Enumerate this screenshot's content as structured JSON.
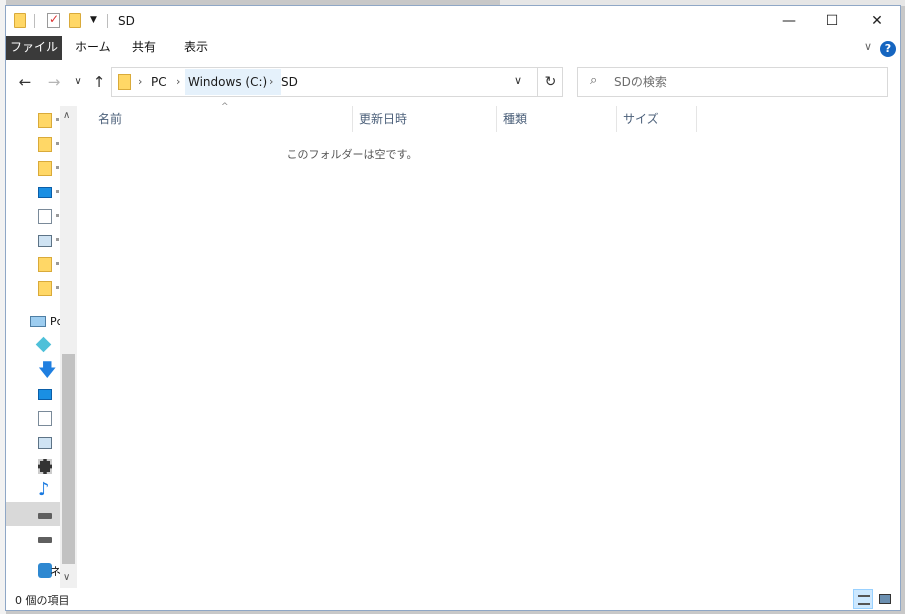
{
  "window": {
    "title": "SD",
    "controls": {
      "minimize": "—",
      "maximize": "☐",
      "close": "✕"
    }
  },
  "ribbon": {
    "tabs": [
      "ファイル",
      "ホーム",
      "共有",
      "表示"
    ],
    "collapse_glyph": "∨",
    "help_glyph": "?"
  },
  "navigation": {
    "back": "←",
    "forward": "→",
    "recent": "∨",
    "up": "↑"
  },
  "address": {
    "breadcrumbs": [
      "PC",
      "Windows (C:)",
      "SD"
    ],
    "separator": "›",
    "dropdown_glyph": "∨",
    "refresh_glyph": "↻"
  },
  "search": {
    "placeholder": "SDの検索",
    "icon": "search-icon"
  },
  "nav_pane": {
    "items": [
      {
        "icon": "folder-icon"
      },
      {
        "icon": "folder-icon"
      },
      {
        "icon": "folder-icon"
      },
      {
        "icon": "desktop-icon"
      },
      {
        "icon": "document-icon"
      },
      {
        "icon": "pictures-icon"
      },
      {
        "icon": "folder-icon"
      },
      {
        "icon": "folder-icon"
      },
      {
        "icon": "pc-icon",
        "label": "Pc"
      },
      {
        "icon": "3d-objects-icon"
      },
      {
        "icon": "downloads-icon"
      },
      {
        "icon": "desktop-icon"
      },
      {
        "icon": "document-icon"
      },
      {
        "icon": "pictures-icon"
      },
      {
        "icon": "videos-icon"
      },
      {
        "icon": "music-icon"
      },
      {
        "icon": "drive-icon"
      },
      {
        "icon": "drive-icon"
      },
      {
        "icon": "network-icon",
        "label": "ネ"
      }
    ],
    "scroll_up": "∧",
    "scroll_down": "∨"
  },
  "columns": [
    "名前",
    "更新日時",
    "種類",
    "サイズ"
  ],
  "sort_glyph": "^",
  "empty_message": "このフォルダーは空です。",
  "status": {
    "item_count": "0 個の項目"
  },
  "colors": {
    "accent": "#1979ca",
    "selection": "#cde8ff",
    "header_text": "#4c607a",
    "folder": "#ffd766"
  }
}
